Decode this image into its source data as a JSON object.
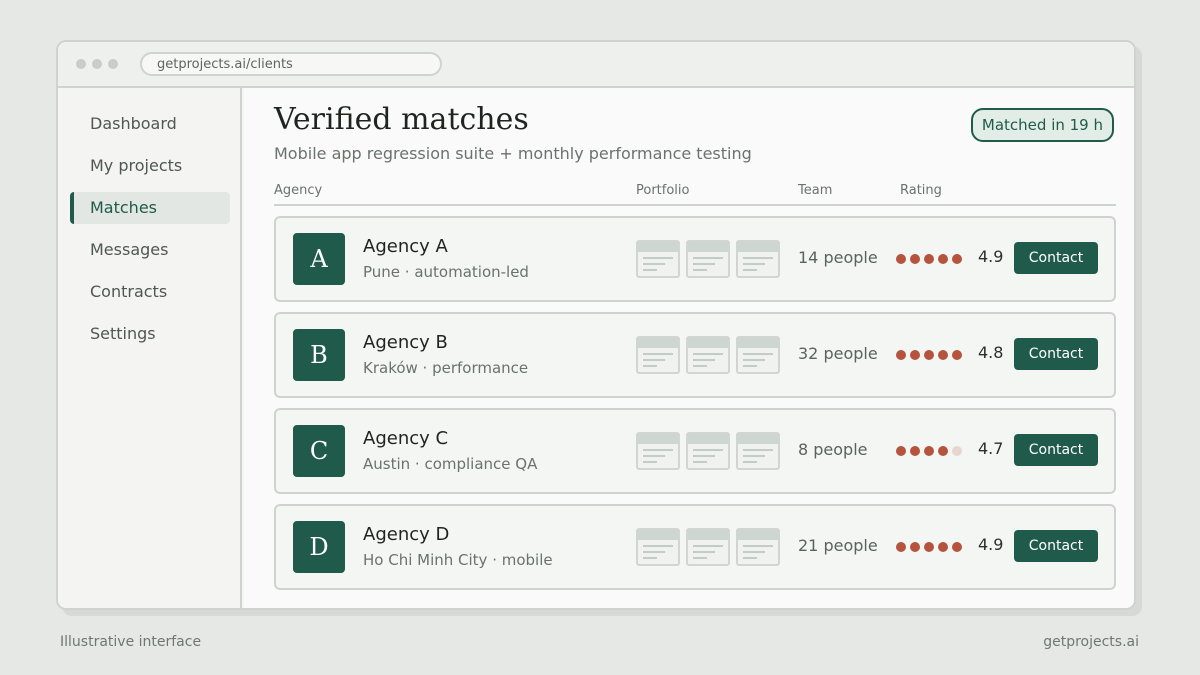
{
  "browser": {
    "url": "getprojects.ai/clients"
  },
  "sidebar": {
    "items": [
      {
        "label": "Dashboard",
        "active": false
      },
      {
        "label": "My projects",
        "active": false
      },
      {
        "label": "Matches",
        "active": true
      },
      {
        "label": "Messages",
        "active": false
      },
      {
        "label": "Contracts",
        "active": false
      },
      {
        "label": "Settings",
        "active": false
      }
    ]
  },
  "main": {
    "title": "Verified matches",
    "subtitle": "Mobile app regression suite + monthly performance testing",
    "badge": "Matched in 19 h",
    "columns": {
      "agency": "Agency",
      "portfolio": "Portfolio",
      "team": "Team",
      "rating": "Rating"
    },
    "agencies": [
      {
        "initial": "A",
        "name": "Agency A",
        "meta": "Pune · automation-led",
        "team": "14 people",
        "dots_filled": 5,
        "score": "4.9",
        "button": "Contact"
      },
      {
        "initial": "B",
        "name": "Agency B",
        "meta": "Kraków · performance",
        "team": "32 people",
        "dots_filled": 5,
        "score": "4.8",
        "button": "Contact"
      },
      {
        "initial": "C",
        "name": "Agency C",
        "meta": "Austin · compliance QA",
        "team": "8 people",
        "dots_filled": 4,
        "score": "4.7",
        "button": "Contact"
      },
      {
        "initial": "D",
        "name": "Agency D",
        "meta": "Ho Chi Minh City · mobile",
        "team": "21 people",
        "dots_filled": 5,
        "score": "4.9",
        "button": "Contact"
      }
    ]
  },
  "footer": {
    "left": "Illustrative interface",
    "right": "getprojects.ai"
  },
  "colors": {
    "accent": "#1f5a4b",
    "rating_dot": "#b5533f",
    "rating_dot_empty": "#e7d5d0",
    "background": "#e6e8e5"
  }
}
